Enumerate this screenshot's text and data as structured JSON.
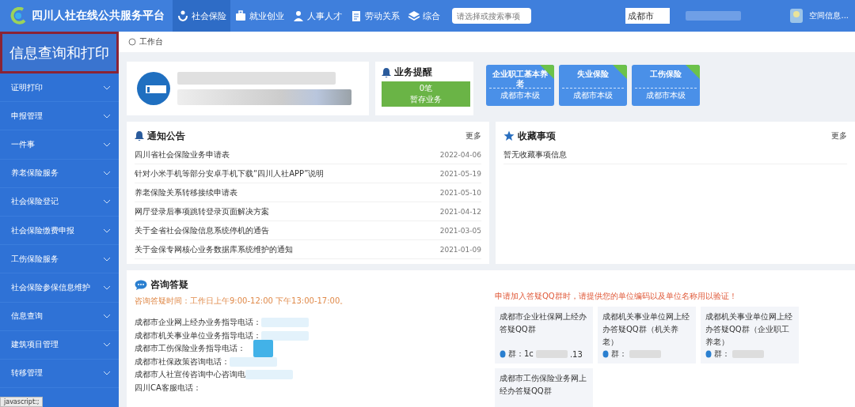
{
  "header": {
    "title": "四川人社在线公共服务平台",
    "tabs": [
      {
        "label": "社会保险",
        "selected": true
      },
      {
        "label": "就业创业",
        "selected": false
      },
      {
        "label": "人事人才",
        "selected": false
      },
      {
        "label": "劳动关系",
        "selected": false
      },
      {
        "label": "综合",
        "selected": false
      }
    ],
    "search": {
      "placeholder": "请选择或搜索事项"
    },
    "city": {
      "value": "成都市"
    },
    "user": {
      "label": "空间信息..."
    }
  },
  "sidebar": {
    "title": "信息查询和打印",
    "items": [
      {
        "label": "证明打印",
        "expanded": false
      },
      {
        "label": "申报管理",
        "expanded": false
      },
      {
        "label": "一件事",
        "expanded": false
      },
      {
        "label": "养老保险服务",
        "expanded": false
      },
      {
        "label": "社会保险登记",
        "expanded": false
      },
      {
        "label": "社会保险缴费申报",
        "expanded": false
      },
      {
        "label": "工伤保险服务",
        "expanded": false
      },
      {
        "label": "社会保险参保信息维护",
        "expanded": false
      },
      {
        "label": "信息查询",
        "expanded": false
      },
      {
        "label": "建筑项目管理",
        "expanded": false
      },
      {
        "label": "转移管理",
        "expanded": false
      }
    ]
  },
  "breadcrumb": {
    "label": "工作台"
  },
  "reminder": {
    "title": "业务提醒",
    "count": "0笔",
    "label": "暂存业务"
  },
  "insurance_cards": [
    {
      "title": "企业职工基本养老",
      "region": "成都市本级"
    },
    {
      "title": "失业保险",
      "region": "成都市本级"
    },
    {
      "title": "工伤保险",
      "region": "成都市本级"
    }
  ],
  "notices": {
    "title": "通知公告",
    "more": "更多",
    "rows": [
      {
        "title": "四川省社会保险业务申请表",
        "date": "2022-04-06"
      },
      {
        "title": "针对小米手机等部分安卓手机下载“四川人社APP”说明",
        "date": "2021-05-19"
      },
      {
        "title": "养老保险关系转移接续申请表",
        "date": "2021-05-10"
      },
      {
        "title": "网厅登录后事项跳转登录页面解决方案",
        "date": "2021-04-12"
      },
      {
        "title": "关于全省社会保险信息系统停机的通告",
        "date": "2021-03-05"
      },
      {
        "title": "关于金保专网核心业务数据库系统维护的通知",
        "date": "2021-01-09"
      }
    ]
  },
  "favorites": {
    "title": "收藏事项",
    "more": "更多",
    "empty": "暂无收藏事项信息"
  },
  "consult": {
    "title": "咨询答疑",
    "hours": "咨询答疑时间：工作日上午9:00-12:00 下午13:00-17:00。",
    "phones": [
      "成都市企业网上经办业务指导电话：",
      "成都市机关事业单位业务指导电话：",
      "成都市工伤保险业务指导电话：",
      "成都市社保政策咨询电话：",
      "成都市人社宣传咨询中心咨询电",
      "四川CA客服电话："
    ],
    "qq_notice": "申请加入答疑QQ群时，请提供您的单位编码以及单位名称用以验证！",
    "qq_groups": [
      {
        "name": "成都市企业社保网上经办答疑QQ群",
        "qq": "群：1c",
        "qq_tail": ".13"
      },
      {
        "name": "成都机关事业单位网上经办答疑QQ群（机关养老）",
        "qq": "群："
      },
      {
        "name": "成都机关事业单位网上经办答疑QQ群（企业职工养老）",
        "qq": "群："
      },
      {
        "name": "成都市工伤保险业务网上经办答疑QQ群"
      }
    ]
  },
  "status_bar": {
    "text": "javascript:;"
  }
}
